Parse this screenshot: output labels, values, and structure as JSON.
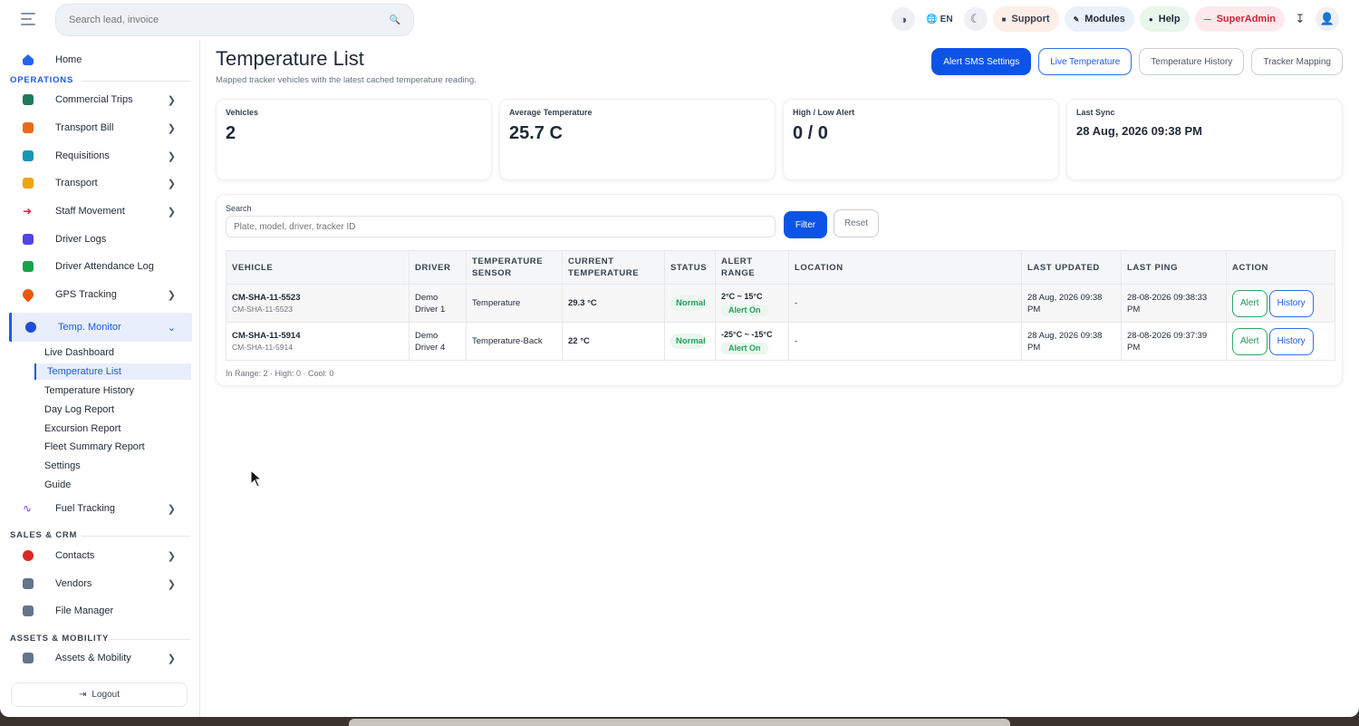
{
  "header": {
    "search_placeholder": "Search lead, invoice",
    "lang": "EN",
    "support": "Support",
    "modules": "Modules",
    "help": "Help",
    "admin": "SuperAdmin"
  },
  "sidebar": {
    "home": "Home",
    "sections": {
      "operations": "OPERATIONS",
      "sales": "SALES & CRM",
      "assets": "ASSETS & MOBILITY"
    },
    "items": [
      {
        "label": "Commercial Trips",
        "color": "#1f7a5a"
      },
      {
        "label": "Transport Bill",
        "color": "#ea6a1a"
      },
      {
        "label": "Requisitions",
        "color": "#1596b8"
      },
      {
        "label": "Transport",
        "color": "#f0a20a"
      },
      {
        "label": "Staff Movement",
        "color": "#e11d48"
      },
      {
        "label": "Driver Logs",
        "color": "#4f46e5"
      },
      {
        "label": "Driver Attendance Log",
        "color": "#16a34a"
      },
      {
        "label": "GPS Tracking",
        "color": "#ea580c"
      },
      {
        "label": "Temp. Monitor",
        "color": "#1d4ed8"
      }
    ],
    "sub_items": [
      "Live Dashboard",
      "Temperature List",
      "Temperature History",
      "Day Log Report",
      "Excursion Report",
      "Fleet Summary Report",
      "Settings",
      "Guide"
    ],
    "fuel": "Fuel Tracking",
    "contacts": "Contacts",
    "vendors": "Vendors",
    "file_manager": "File Manager",
    "assets_mobility": "Assets & Mobility",
    "logout": "Logout"
  },
  "page": {
    "title": "Temperature List",
    "subtitle": "Mapped tracker vehicles with the latest cached temperature reading.",
    "buttons": {
      "alert_sms": "Alert SMS Settings",
      "live_temp": "Live Temperature",
      "history": "Temperature History",
      "tracker": "Tracker Mapping"
    }
  },
  "stats": {
    "vehicles_label": "Vehicles",
    "vehicles_value": "2",
    "avg_label": "Average Temperature",
    "avg_value": "25.7 C",
    "alert_label": "High / Low Alert",
    "alert_value": "0 / 0",
    "sync_label": "Last Sync",
    "sync_value": "28 Aug, 2026 09:38 PM"
  },
  "filter": {
    "label": "Search",
    "placeholder": "Plate, model, driver, tracker ID",
    "filter_btn": "Filter",
    "reset_btn": "Reset"
  },
  "table": {
    "headers": [
      "VEHICLE",
      "DRIVER",
      "TEMPERATURE SENSOR",
      "CURRENT TEMPERATURE",
      "STATUS",
      "ALERT RANGE",
      "LOCATION",
      "LAST UPDATED",
      "LAST PING",
      "ACTION"
    ],
    "rows": [
      {
        "plate": "CM-SHA-11-5523",
        "plate_sub": "CM-SHA-11-5523",
        "driver": "Demo Driver 1",
        "sensor": "Temperature",
        "temp": "29.3 °C",
        "status": "Normal",
        "range": "2°C ~ 15°C",
        "alert": "Alert On",
        "location": "-",
        "updated": "28 Aug, 2026 09:38 PM",
        "ping": "28-08-2026 09:38:33 PM",
        "alert_btn": "Alert",
        "history_btn": "History"
      },
      {
        "plate": "CM-SHA-11-5914",
        "plate_sub": "CM-SHA-11-5914",
        "driver": "Demo Driver 4",
        "sensor": "Temperature-Back",
        "temp": "22 °C",
        "status": "Normal",
        "range": "-25°C ~ -15°C",
        "alert": "Alert On",
        "location": "-",
        "updated": "28 Aug, 2026 09:38 PM",
        "ping": "28-08-2026 09:37:39 PM",
        "alert_btn": "Alert",
        "history_btn": "History"
      }
    ],
    "summary": "In Range: 2 · High: 0 · Cool: 0"
  }
}
